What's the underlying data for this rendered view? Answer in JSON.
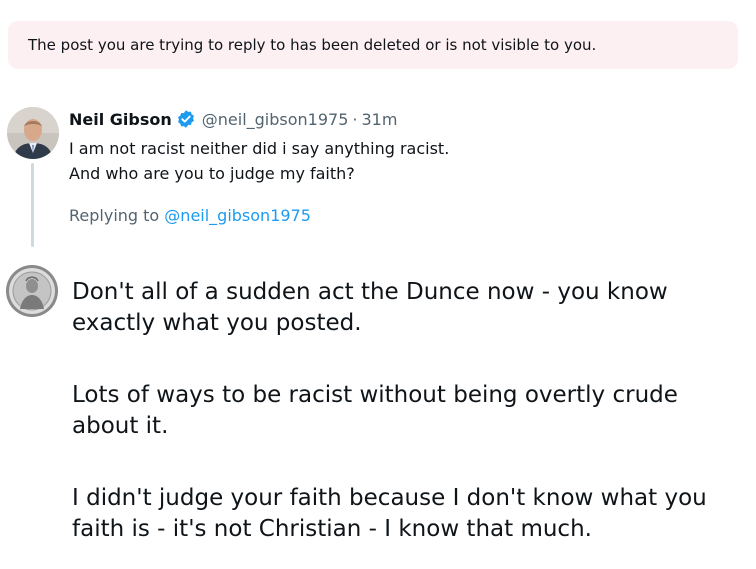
{
  "notice": {
    "text": "The post you are trying to reply to has been deleted or is not visible to you."
  },
  "original_post": {
    "author_name": "Neil Gibson",
    "handle": "@neil_gibson1975",
    "separator": "·",
    "time": "31m",
    "text_lines": [
      "I am not racist neither did i say anything racist.",
      "And who are you to judge my faith?"
    ],
    "replying_prefix": "Replying to",
    "replying_handle": "@neil_gibson1975",
    "verified_color": "#1d9bf0"
  },
  "reply": {
    "paragraphs": [
      [
        "Don't all of a sudden act the Dunce now - you know",
        "exactly what you posted."
      ],
      [
        "Lots of ways to be racist without being overtly crude",
        "about it."
      ],
      [
        "I didn't judge your faith because I don't know what you",
        "faith is - it's not Christian - I know that much."
      ]
    ]
  },
  "colors": {
    "notice_bg": "#fdf0f2",
    "text_primary": "#0f1419",
    "text_secondary": "#536471",
    "link": "#1d9bf0",
    "thread_line": "#cfd9de"
  }
}
